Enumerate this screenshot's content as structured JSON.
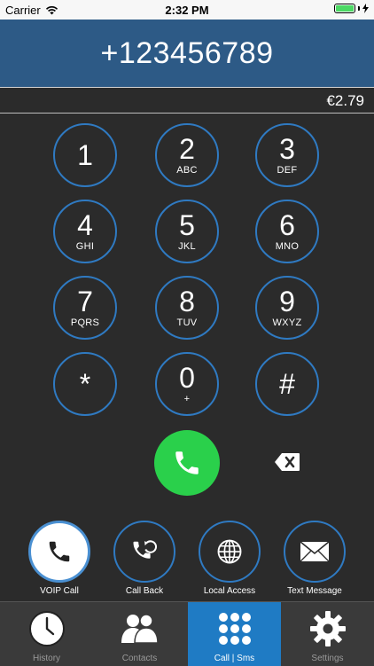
{
  "status_bar": {
    "carrier": "Carrier",
    "time": "2:32 PM"
  },
  "dialer": {
    "number": "+123456789",
    "balance": "€2.79"
  },
  "keypad": {
    "keys": [
      {
        "digit": "1",
        "letters": ""
      },
      {
        "digit": "2",
        "letters": "ABC"
      },
      {
        "digit": "3",
        "letters": "DEF"
      },
      {
        "digit": "4",
        "letters": "GHI"
      },
      {
        "digit": "5",
        "letters": "JKL"
      },
      {
        "digit": "6",
        "letters": "MNO"
      },
      {
        "digit": "7",
        "letters": "PQRS"
      },
      {
        "digit": "8",
        "letters": "TUV"
      },
      {
        "digit": "9",
        "letters": "WXYZ"
      },
      {
        "digit": "*",
        "letters": ""
      },
      {
        "digit": "0",
        "letters": "+"
      },
      {
        "digit": "#",
        "letters": ""
      }
    ]
  },
  "call_modes": [
    {
      "label": "VOIP Call",
      "icon": "phone-icon",
      "active": true
    },
    {
      "label": "Call Back",
      "icon": "callback-icon",
      "active": false
    },
    {
      "label": "Local Access",
      "icon": "globe-icon",
      "active": false
    },
    {
      "label": "Text Message",
      "icon": "envelope-icon",
      "active": false
    }
  ],
  "tabs": [
    {
      "label": "History",
      "icon": "clock-icon",
      "active": false
    },
    {
      "label": "Contacts",
      "icon": "contacts-icon",
      "active": false
    },
    {
      "label": "Call | Sms",
      "icon": "keypad-icon",
      "active": true
    },
    {
      "label": "Settings",
      "icon": "gear-icon",
      "active": false
    }
  ],
  "colors": {
    "header": "#2d5a86",
    "key_ring": "#2f7ac2",
    "call_green": "#2ad04b",
    "tab_active": "#1f7bc4"
  }
}
